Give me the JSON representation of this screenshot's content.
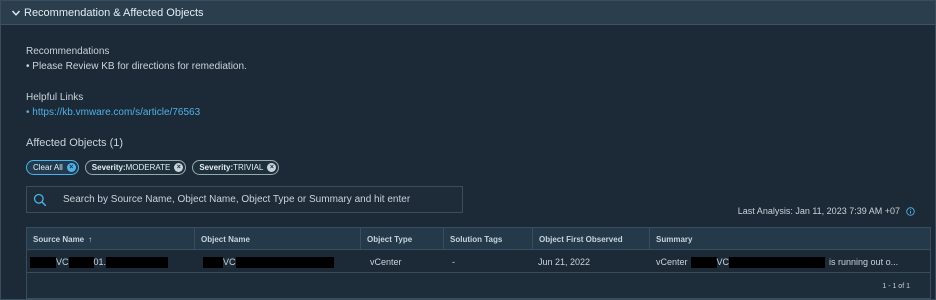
{
  "section": {
    "title": "Recommendation & Affected Objects"
  },
  "recommendations": {
    "label": "Recommendations",
    "item": "• Please Review KB for directions for remediation."
  },
  "helpful_links": {
    "label": "Helpful Links",
    "link": "• https://kb.vmware.com/s/article/76563"
  },
  "affected": {
    "title": "Affected Objects (1)"
  },
  "filters": {
    "clear_label": "Clear All",
    "chips": [
      {
        "key": "Severity:",
        "value": "MODERATE"
      },
      {
        "key": "Severity:",
        "value": "TRIVIAL"
      }
    ]
  },
  "search": {
    "placeholder": "Search by Source Name, Object Name, Object Type or Summary and hit enter"
  },
  "last_analysis": "Last Analysis: Jan 11, 2023 7:39 AM +07",
  "table": {
    "headers": {
      "source_name": "Source Name",
      "object_name": "Object Name",
      "object_type": "Object Type",
      "solution_tags": "Solution Tags",
      "first_observed": "Object First Observed",
      "summary": "Summary"
    },
    "rows": [
      {
        "source_a": "VC",
        "source_b": "01.",
        "object_name": "VC",
        "object_type": "vCenter",
        "solution_tags": "-",
        "first_observed": "Jun 21, 2022",
        "summary_a": "vCenter",
        "summary_b": "VC",
        "summary_c": "is running out o..."
      }
    ],
    "pager": "1 - 1 of 1"
  },
  "colors": {
    "accent": "#4fb1e8",
    "background": "#1b2a36",
    "header": "#2b3e4d"
  }
}
